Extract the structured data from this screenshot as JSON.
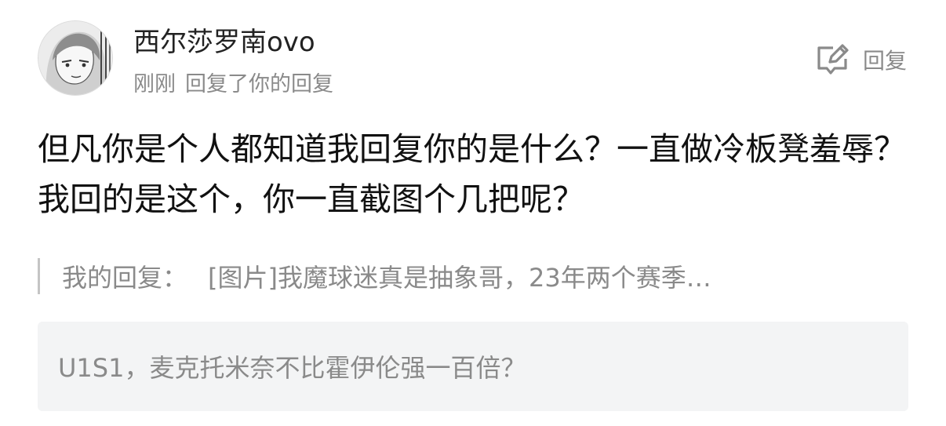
{
  "user": {
    "name": "西尔莎罗南ovo"
  },
  "meta": {
    "time": "刚刚",
    "action": "回复了你的回复"
  },
  "reply_button": {
    "label": "回复",
    "icon": "edit-icon"
  },
  "comment": {
    "text": "但凡你是个人都知道我回复你的是什么？一直做冷板凳羞辱？我回的是这个，你一直截图个几把呢？"
  },
  "quoted_reply": {
    "prefix": "我的回复：",
    "text": "[图片]我魔球迷真是抽象哥，23年两个赛季…"
  },
  "original_post": {
    "text": "U1S1，麦克托米奈不比霍伊伦强一百倍？"
  },
  "colors": {
    "text_primary": "#111111",
    "text_secondary": "#8a8a8a",
    "quote_bar": "#c4c4c4",
    "ref_background": "#f3f4f5"
  }
}
